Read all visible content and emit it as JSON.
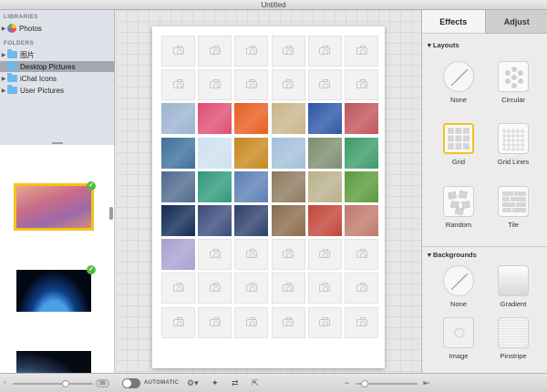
{
  "window": {
    "title": "Untitled"
  },
  "sidebar": {
    "libraries_header": "LIBRARIES",
    "libraries": [
      {
        "label": "Photos",
        "icon": "photos-app-icon"
      }
    ],
    "folders_header": "FOLDERS",
    "folders": [
      {
        "label": "图片",
        "selected": false
      },
      {
        "label": "Desktop Pictures",
        "selected": true
      },
      {
        "label": "iChat Icons",
        "selected": false
      },
      {
        "label": "User Pictures",
        "selected": false
      }
    ]
  },
  "strip": {
    "thumbnails": [
      {
        "name": "pink-clouds",
        "selected": true,
        "used": true
      },
      {
        "name": "earth-horizon",
        "selected": false,
        "used": true
      },
      {
        "name": "earth-from-space",
        "selected": false,
        "used": false
      }
    ]
  },
  "grid": {
    "columns": 6,
    "rows": 9,
    "filled_rows": [
      2,
      3,
      4,
      5,
      6
    ],
    "photos": [
      [
        "#9ab3cf",
        "#e04d72",
        "#e85d1f",
        "#c9b58a",
        "#2c56a6",
        "#c0545b"
      ],
      [
        "#3e6f9b",
        "#cfe0f0",
        "#c7871d",
        "#a3bfd9",
        "#7b8d6e",
        "#3b9b6a"
      ],
      [
        "#4e6a8c",
        "#2f9a7a",
        "#5a7fb5",
        "#8c7a5e",
        "#b9b08a",
        "#5a9a3a"
      ],
      [
        "#0f2a55",
        "#3b4a7a",
        "#2c3f6a",
        "#8a6b4a",
        "#c2453a",
        "#c0786a"
      ],
      [
        "#a9a0d0"
      ]
    ]
  },
  "inspector": {
    "tabs": [
      {
        "label": "Effects",
        "active": true
      },
      {
        "label": "Adjust",
        "active": false
      }
    ],
    "layouts_header": "Layouts",
    "layouts": [
      {
        "label": "None",
        "icon": "none-icon",
        "selected": false
      },
      {
        "label": "Circular",
        "icon": "circular-layout-icon",
        "selected": false
      },
      {
        "label": "Grid",
        "icon": "grid-layout-icon",
        "selected": true
      },
      {
        "label": "Grid Lines",
        "icon": "grid-lines-icon",
        "selected": false
      },
      {
        "label": "Random",
        "icon": "random-layout-icon",
        "selected": false
      },
      {
        "label": "Tile",
        "icon": "tile-layout-icon",
        "selected": false
      }
    ],
    "backgrounds_header": "Backgrounds",
    "backgrounds": [
      {
        "label": "None",
        "icon": "none-icon"
      },
      {
        "label": "Gradient",
        "icon": "gradient-icon"
      },
      {
        "label": "Image",
        "icon": "image-bg-icon"
      },
      {
        "label": "Pinstripe",
        "icon": "pinstripe-icon"
      }
    ]
  },
  "toolbar": {
    "thumb_size_badge": "36",
    "automatic_label": "AUTOMATIC",
    "accent_color": "#f2c417"
  }
}
